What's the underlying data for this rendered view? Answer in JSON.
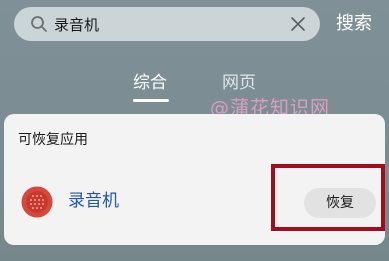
{
  "search": {
    "value": "录音机",
    "button_label": "搜索"
  },
  "tabs": [
    {
      "label": "综合",
      "active": true
    },
    {
      "label": "网页",
      "active": false
    }
  ],
  "watermark": "@蒲花知识网",
  "recoverable_section": {
    "title": "可恢复应用",
    "apps": [
      {
        "name": "录音机",
        "icon": "recorder-app-icon",
        "action_label": "恢复"
      }
    ]
  },
  "colors": {
    "app_name": "#1e56b8",
    "highlight_box": "#a00d1c",
    "recorder_icon": "#d9473b"
  }
}
